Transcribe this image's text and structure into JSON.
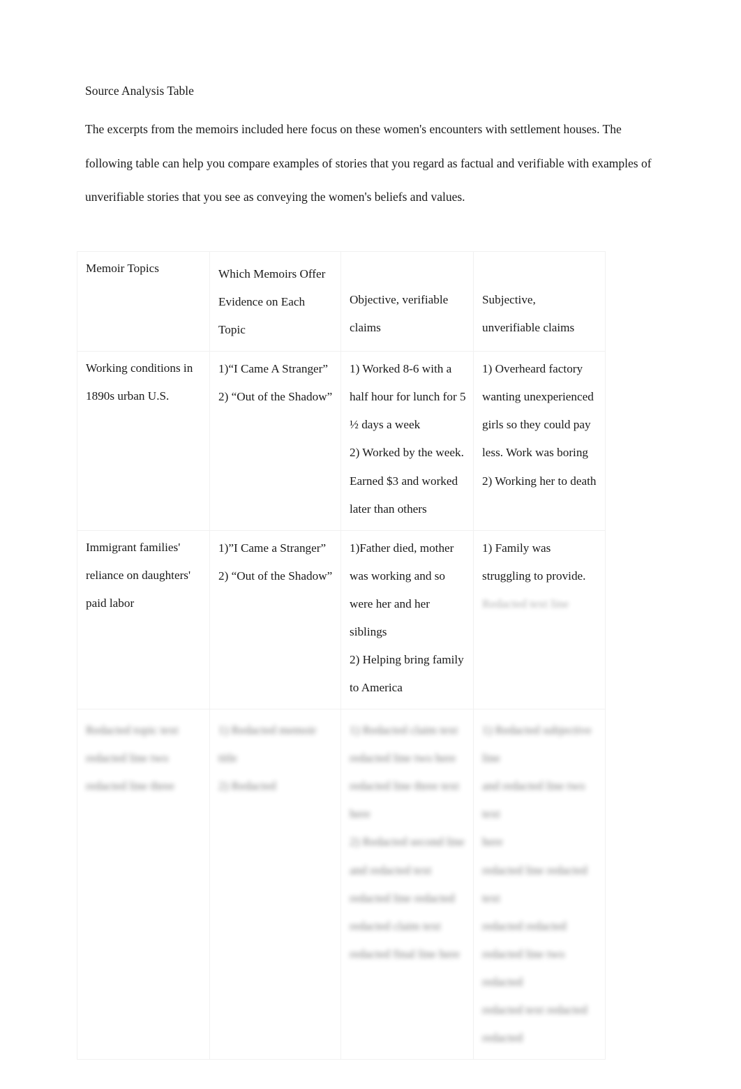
{
  "document": {
    "title": "Source Analysis Table",
    "intro": "The excerpts from the memoirs included here focus on these women's encounters with settlement houses. The following table can help you compare examples of stories that you regard as factual and verifiable with examples of unverifiable stories that you see as conveying the women's beliefs and values."
  },
  "table": {
    "headers": {
      "col1": "Memoir Topics",
      "col2": "Which Memoirs Offer\nEvidence on Each\nTopic",
      "col3": "Objective, verifiable\nclaims",
      "col4": "Subjective,\nunverifiable claims"
    },
    "rows": [
      {
        "topic": "Working conditions in\n1890s urban U.S.",
        "memoirs": "1)“I Came A Stranger”\n2) “Out of the Shadow”",
        "objective": "1) Worked 8-6 with a\nhalf hour for lunch for 5\n½ days a week\n2) Worked by the week.\nEarned $3 and worked\nlater than others",
        "subjective": "1) Overheard factory\nwanting unexperienced\ngirls so they could pay\nless. Work was boring\n2) Working her to death",
        "redacted": false
      },
      {
        "topic": "Immigrant families'\nreliance on daughters'\npaid labor",
        "memoirs": "1)”I Came a Stranger”\n2) “Out of the Shadow”",
        "objective": "1)Father died, mother\nwas working and so\nwere her and her\nsiblings\n2) Helping bring family\nto America",
        "subjective": "1) Family was\nstruggling to provide.",
        "subjective_redacted_line": "Redacted text line",
        "redacted": false
      },
      {
        "topic": "Redacted topic text\nredacted line two\nredacted line three",
        "memoirs": "1) Redacted memoir title\n2) Redacted",
        "objective": "1) Redacted claim text\nredacted line two here\nredacted line three text\nhere\n2) Redacted second line\nand redacted text\nredacted line redacted\nredacted claim text\nredacted final line here",
        "subjective": "1) Redacted subjective line\nand redacted line two text\nhere\nredacted line redacted text\nredacted redacted\nredacted line two redacted\nredacted text redacted\nredacted",
        "redacted": true
      }
    ]
  }
}
